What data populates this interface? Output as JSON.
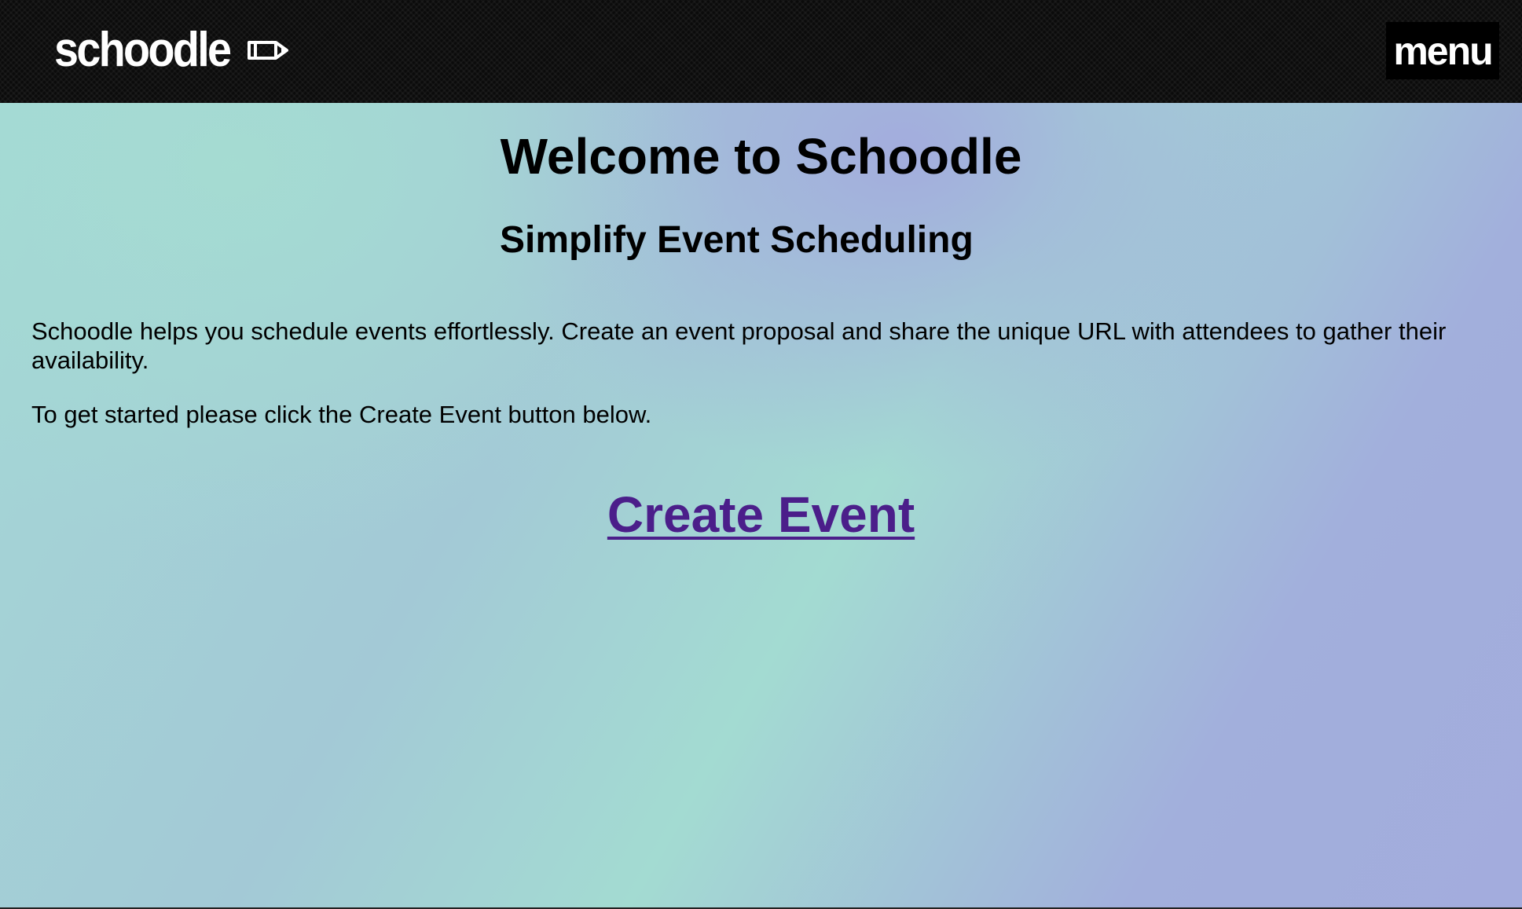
{
  "header": {
    "brand_name": "schoodle",
    "brand_icon": "pencil-icon",
    "menu_label": "menu"
  },
  "main": {
    "title": "Welcome to Schoodle",
    "subtitle": "Simplify Event Scheduling",
    "intro": "Schoodle helps you schedule events effortlessly. Create an event proposal and share the unique URL with attendees to gather their availability.",
    "instruction": "To get started please click the Create Event button below.",
    "create_event_label": "Create Event"
  },
  "colors": {
    "header_bg": "#0b0b0b",
    "link": "#4b1e8a",
    "gradient_teal": "#a3dbd2",
    "gradient_lavender": "#a3acdd"
  }
}
